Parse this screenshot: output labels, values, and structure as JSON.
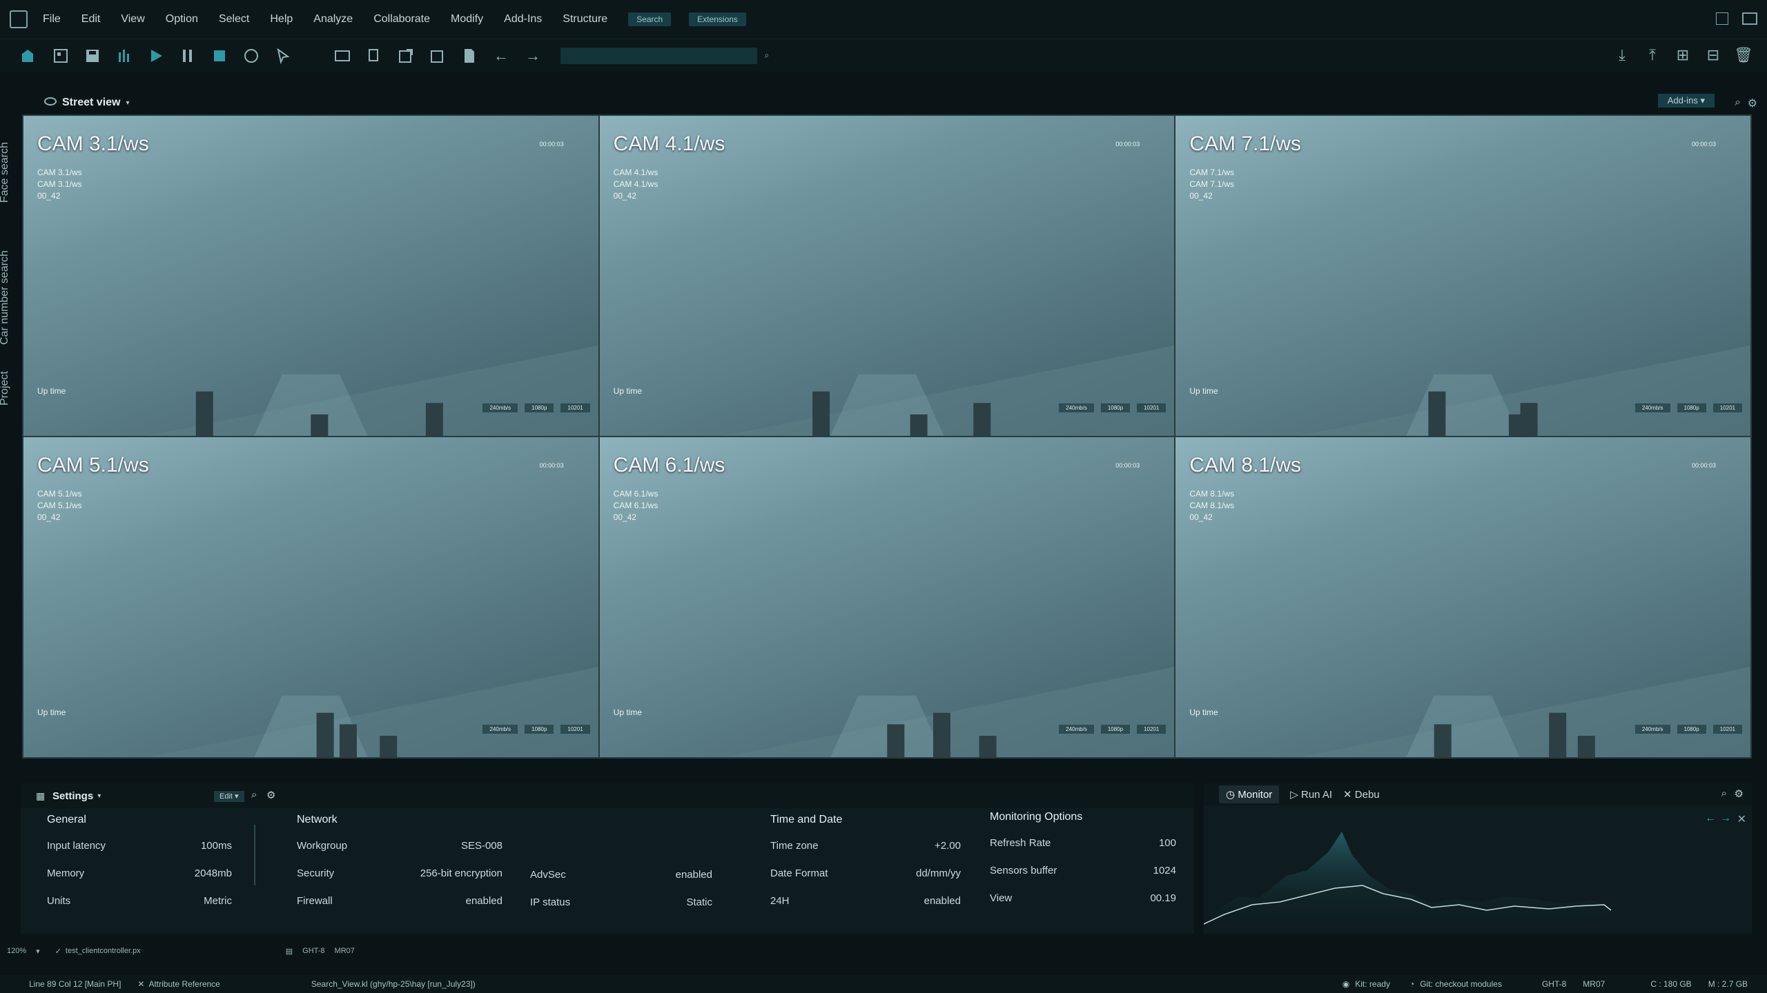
{
  "menu": [
    "File",
    "Edit",
    "View",
    "Option",
    "Select",
    "Help",
    "Analyze",
    "Collaborate",
    "Modify",
    "Add-Ins",
    "Structure"
  ],
  "menu_search": "Search",
  "menu_extensions": "Extensions",
  "view_title": "Street view",
  "addins_label": "Add-ins",
  "sidebar_tabs": [
    "Face search",
    "Car number search",
    "Project"
  ],
  "cameras": [
    {
      "name": "CAM 3.1/ws",
      "line1": "CAM 3.1/ws",
      "line2": "CAM 3.1/ws",
      "line3": "00_42",
      "time": "00:00:03",
      "uptime": "Up time",
      "tags": [
        "240mb/s",
        "1080p",
        "10201"
      ]
    },
    {
      "name": "CAM 4.1/ws",
      "line1": "CAM 4.1/ws",
      "line2": "CAM 4.1/ws",
      "line3": "00_42",
      "time": "00:00:03",
      "uptime": "Up time",
      "tags": [
        "240mb/s",
        "1080p",
        "10201"
      ]
    },
    {
      "name": "CAM 7.1/ws",
      "line1": "CAM 7.1/ws",
      "line2": "CAM 7.1/ws",
      "line3": "00_42",
      "time": "00:00:03",
      "uptime": "Up time",
      "tags": [
        "240mb/s",
        "1080p",
        "10201"
      ]
    },
    {
      "name": "CAM 5.1/ws",
      "line1": "CAM 5.1/ws",
      "line2": "CAM 5.1/ws",
      "line3": "00_42",
      "time": "00:00:03",
      "uptime": "Up time",
      "tags": [
        "240mb/s",
        "1080p",
        "10201"
      ]
    },
    {
      "name": "CAM 6.1/ws",
      "line1": "CAM 6.1/ws",
      "line2": "CAM 6.1/ws",
      "line3": "00_42",
      "time": "00:00:03",
      "uptime": "Up time",
      "tags": [
        "240mb/s",
        "1080p",
        "10201"
      ]
    },
    {
      "name": "CAM 8.1/ws",
      "line1": "CAM 8.1/ws",
      "line2": "CAM 8.1/ws",
      "line3": "00_42",
      "time": "00:00:03",
      "uptime": "Up time",
      "tags": [
        "240mb/s",
        "1080p",
        "10201"
      ]
    }
  ],
  "settings": {
    "title": "Settings",
    "edit": "Edit",
    "general": {
      "heading": "General",
      "rows": [
        [
          "Input latency",
          "100ms"
        ],
        [
          "Memory",
          "2048mb"
        ],
        [
          "Units",
          "Metric"
        ]
      ]
    },
    "network": {
      "heading": "Network",
      "rows": [
        [
          "Workgroup",
          "SES-008"
        ],
        [
          "Security",
          "256-bit encryption"
        ],
        [
          "Firewall",
          "enabled"
        ]
      ]
    },
    "network2": {
      "rows": [
        [
          "AdvSec",
          "enabled"
        ],
        [
          "IP status",
          "Static"
        ]
      ]
    },
    "time": {
      "heading": "Time and Date",
      "rows": [
        [
          "Time zone",
          "+2.00"
        ],
        [
          "Date Format",
          "dd/mm/yy"
        ],
        [
          "24H",
          "enabled"
        ]
      ]
    },
    "monitoring": {
      "heading": "Monitoring Options",
      "rows": [
        [
          "Refresh Rate",
          "100"
        ],
        [
          "Sensors buffer",
          "1024"
        ],
        [
          "View",
          "00.19"
        ]
      ]
    }
  },
  "monitor_tabs": [
    "Monitor",
    "Run AI",
    "Debu"
  ],
  "status1": {
    "zoom": "120%",
    "file": "test_clientcontroller.px",
    "c1": "GHT-8",
    "c2": "MR07"
  },
  "status2": {
    "pos": "Line 89 Col 12 [Main PH]",
    "attr": "Attribute Reference",
    "path": "Search_View.kl (ghy/hp-25\\hay [run_July23])",
    "kit": "Kit: ready",
    "git": "Git: checkout modules",
    "s1": "GHT-8",
    "s2": "MR07",
    "c": "C : 180 GB",
    "m": "M : 2.7 GB"
  },
  "colors": {
    "accent": "#173e44",
    "bg": "#0a1416",
    "panel": "#0e1c1f"
  }
}
